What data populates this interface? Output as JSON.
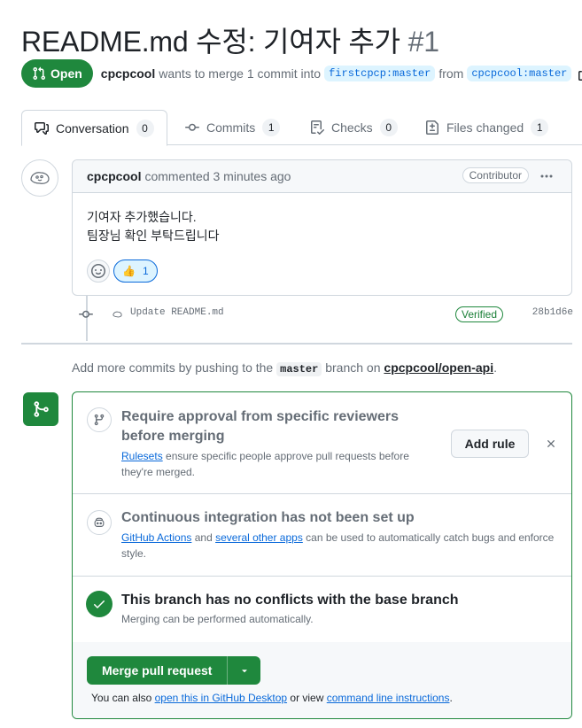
{
  "pr": {
    "title": "README.md 수정: 기여자 추가",
    "number": "#1",
    "state": "Open",
    "author": "cpcpcool",
    "merge_text": "wants to merge 1 commit into",
    "base_branch": "firstcpcp:master",
    "from_text": "from",
    "head_branch": "cpcpcool:master"
  },
  "tabs": [
    {
      "label": "Conversation",
      "count": "0",
      "icon": "comment-discussion-icon"
    },
    {
      "label": "Commits",
      "count": "1",
      "icon": "git-commit-icon"
    },
    {
      "label": "Checks",
      "count": "0",
      "icon": "checklist-icon"
    },
    {
      "label": "Files changed",
      "count": "1",
      "icon": "file-diff-icon"
    }
  ],
  "comment": {
    "author": "cpcpcool",
    "meta": "commented 3 minutes ago",
    "role": "Contributor",
    "body_line1": "기여자 추가했습니다.",
    "body_line2": "팀장님 확인 부탁드립니다",
    "reaction_emoji": "👍",
    "reaction_count": "1"
  },
  "commit": {
    "message": "Update README.md",
    "verified": "Verified",
    "sha": "28b1d6e"
  },
  "push_note": {
    "prefix": "Add more commits by pushing to the",
    "branch": "master",
    "middle": "branch on",
    "repo": "cpcpcool/open-api",
    "suffix": "."
  },
  "mergebox": {
    "rules_title": "Require approval from specific reviewers before merging",
    "rules_link": "Rulesets",
    "rules_desc": "ensure specific people approve pull requests before they're merged.",
    "add_rule": "Add rule",
    "ci_title": "Continuous integration has not been set up",
    "ci_link1": "GitHub Actions",
    "ci_and": "and",
    "ci_link2": "several other apps",
    "ci_desc": "can be used to automatically catch bugs and enforce style.",
    "conflict_title": "This branch has no conflicts with the base branch",
    "conflict_desc": "Merging can be performed automatically.",
    "merge_button": "Merge pull request",
    "also_prefix": "You can also",
    "also_link1": "open this in GitHub Desktop",
    "also_middle": "or view",
    "also_link2": "command line instructions",
    "also_suffix": "."
  },
  "colors": {
    "open_green": "#1f883d",
    "link_blue": "#0969da",
    "muted": "#656d76",
    "border": "#d0d7de"
  }
}
